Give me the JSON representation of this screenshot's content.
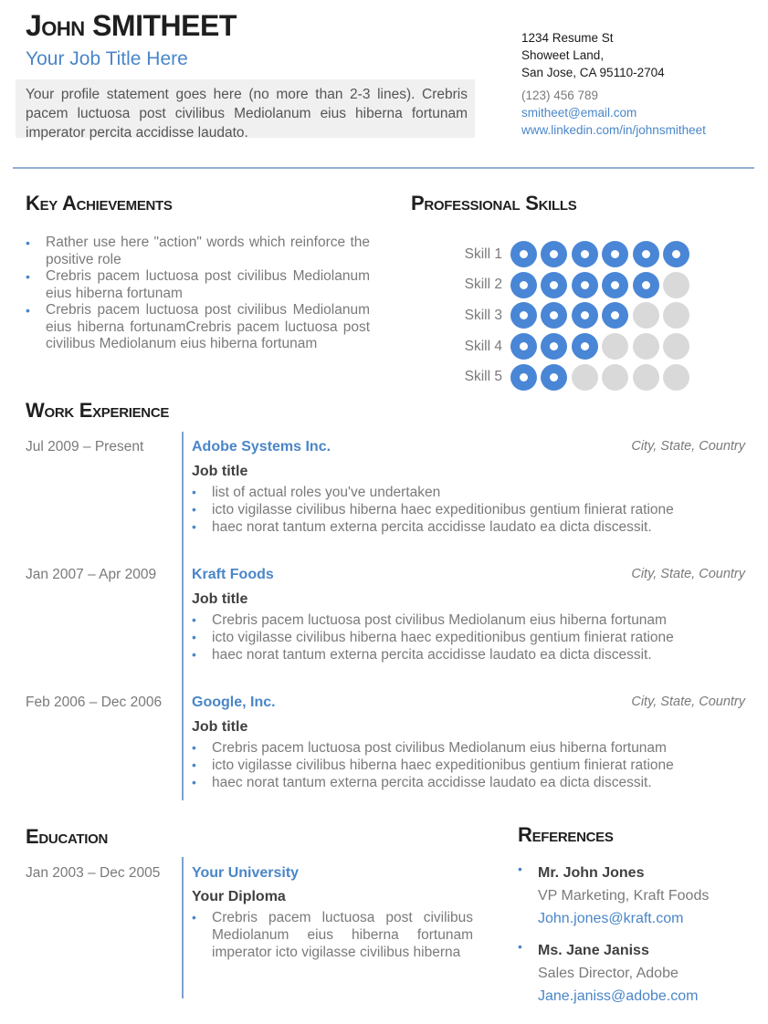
{
  "header": {
    "first_name": "John",
    "last_name": "SMITHEET",
    "job_title": "Your Job Title Here",
    "profile": "Your profile statement goes here (no more than 2-3 lines). Crebris pacem luctuosa post civilibus Mediolanum eius hiberna fortunam imperator percita accidisse laudato."
  },
  "contact": {
    "address_line1": "1234 Resume St",
    "address_line2": "Showeet Land,",
    "address_line3": "San Jose, CA 95110-2704",
    "phone": "(123) 456 789",
    "email": "smitheet@email.com",
    "linkedin": "www.linkedin.com/in/johnsmitheet"
  },
  "achievements": {
    "title": "Key Achievements",
    "items": [
      "Rather use here \"action\" words which reinforce the positive role",
      "Crebris pacem luctuosa post civilibus Mediolanum eius hiberna fortunam",
      "Crebris pacem luctuosa post civilibus Mediolanum eius hiberna fortunamCrebris pacem luctuosa post civilibus Mediolanum eius hiberna fortunam"
    ]
  },
  "skills": {
    "title": "Professional Skills",
    "max_level": 6,
    "items": [
      {
        "label": "Skill 1",
        "level": 6
      },
      {
        "label": "Skill 2",
        "level": 5
      },
      {
        "label": "Skill 3",
        "level": 4
      },
      {
        "label": "Skill 4",
        "level": 3
      },
      {
        "label": "Skill 5",
        "level": 2
      }
    ]
  },
  "experience": {
    "title": "Work Experience",
    "jobs": [
      {
        "dates": "Jul 2009 – Present",
        "company": "Adobe Systems Inc.",
        "location": "City, State, Country",
        "role": "Job title",
        "duties": [
          "list of actual roles you've undertaken",
          "icto vigilasse civilibus hiberna haec expeditionibus gentium finierat ratione",
          "haec norat tantum externa percita accidisse laudato ea dicta discessit."
        ]
      },
      {
        "dates": "Jan 2007 – Apr 2009",
        "company": "Kraft Foods",
        "location": "City, State, Country",
        "role": "Job title",
        "duties": [
          "Crebris pacem luctuosa post civilibus Mediolanum eius hiberna fortunam",
          "icto vigilasse civilibus hiberna haec expeditionibus gentium finierat ratione",
          "haec norat tantum externa percita accidisse laudato ea dicta discessit."
        ]
      },
      {
        "dates": "Feb 2006 – Dec 2006",
        "company": "Google, Inc.",
        "location": "City, State, Country",
        "role": "Job title",
        "duties": [
          "Crebris pacem luctuosa post civilibus Mediolanum eius hiberna fortunam",
          "icto vigilasse civilibus hiberna haec expeditionibus gentium finierat ratione",
          "haec norat tantum externa percita accidisse laudato ea dicta discessit."
        ]
      }
    ]
  },
  "education": {
    "title": "Education",
    "dates": "Jan 2003 – Dec 2005",
    "school": "Your University",
    "diploma": "Your Diploma",
    "details": [
      "Crebris pacem luctuosa post civilibus Mediolanum eius hiberna fortunam imperator icto vigilasse civilibus hiberna"
    ]
  },
  "references": {
    "title": "References",
    "items": [
      {
        "name": "Mr. John Jones",
        "role": "VP Marketing, Kraft Foods",
        "email": "John.jones@kraft.com"
      },
      {
        "name": "Ms. Jane Janiss",
        "role": "Sales Director, Adobe",
        "email": "Jane.janiss@adobe.com"
      }
    ]
  },
  "colors": {
    "accent": "#4a86c8",
    "skill_on": "#4a86d6",
    "skill_off": "#d9d9d9",
    "profile_bg": "#f0f0f0"
  }
}
